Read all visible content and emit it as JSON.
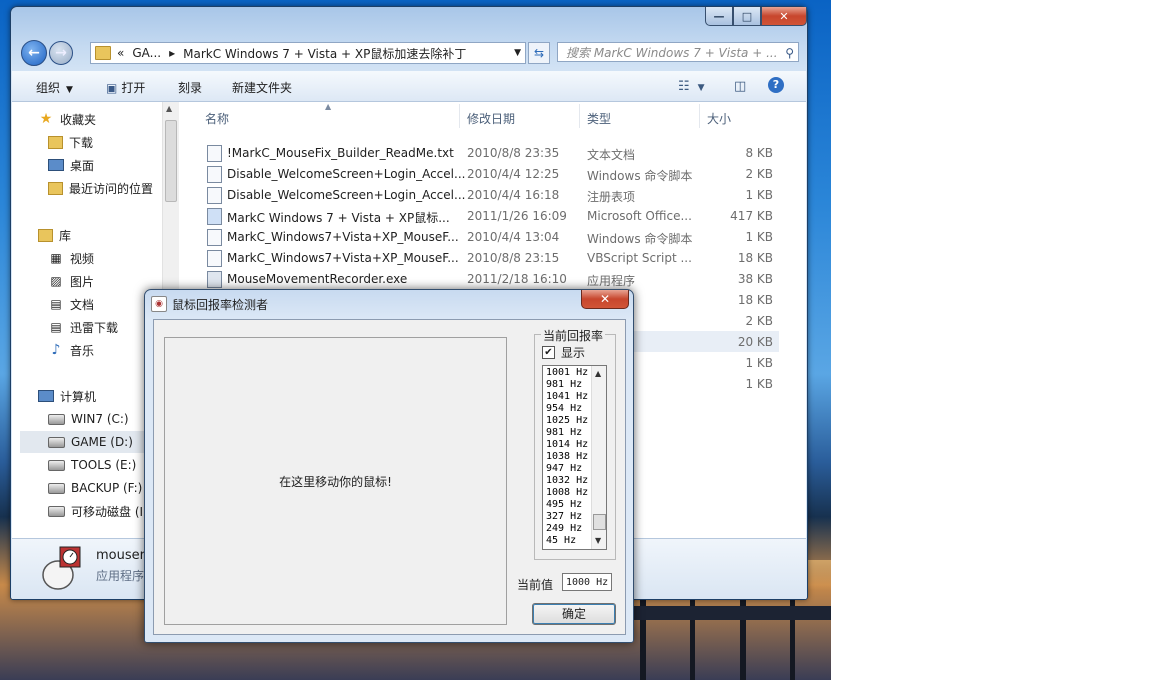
{
  "explorer": {
    "address_segments": [
      "«",
      "GA...",
      "▸",
      "MarkC Windows 7 + Vista + XP鼠标加速去除补丁"
    ],
    "search_placeholder": "搜索 MarkC Windows 7 + Vista + ...",
    "toolbar": {
      "organize": "组织",
      "open": "打开",
      "burn": "刻录",
      "new_folder": "新建文件夹"
    },
    "nav": {
      "favorites_header": "收藏夹",
      "favorites": [
        "下载",
        "桌面",
        "最近访问的位置"
      ],
      "libraries_header": "库",
      "libraries": [
        "视频",
        "图片",
        "文档",
        "迅雷下载",
        "音乐"
      ],
      "computer_header": "计算机",
      "drives": [
        "WIN7 (C:)",
        "GAME (D:)",
        "TOOLS (E:)",
        "BACKUP (F:)",
        "可移动磁盘 (I:"
      ]
    },
    "columns": {
      "name": "名称",
      "date": "修改日期",
      "type": "类型",
      "size": "大小"
    },
    "files": [
      {
        "name": "!MarkC_MouseFix_Builder_ReadMe.txt",
        "date": "2010/8/8 23:35",
        "type": "文本文档",
        "size": "8 KB"
      },
      {
        "name": "Disable_WelcomeScreen+Login_Accel...",
        "date": "2010/4/4 12:25",
        "type": "Windows 命令脚本",
        "size": "2 KB"
      },
      {
        "name": "Disable_WelcomeScreen+Login_Accel...",
        "date": "2010/4/4 16:18",
        "type": "注册表项",
        "size": "1 KB"
      },
      {
        "name": "MarkC Windows 7 + Vista + XP鼠标...",
        "date": "2011/1/26 16:09",
        "type": "Microsoft Office...",
        "size": "417 KB"
      },
      {
        "name": "MarkC_Windows7+Vista+XP_MouseF...",
        "date": "2010/4/4 13:04",
        "type": "Windows 命令脚本",
        "size": "1 KB"
      },
      {
        "name": "MarkC_Windows7+Vista+XP_MouseF...",
        "date": "2010/8/8 23:15",
        "type": "VBScript Script ...",
        "size": "18 KB"
      },
      {
        "name": "MouseMovementRecorder.exe",
        "date": "2011/2/18 16:10",
        "type": "应用程序",
        "size": "38 KB"
      }
    ],
    "hidden_sizes": [
      "18 KB",
      "2 KB",
      "20 KB",
      "1 KB",
      "1 KB"
    ],
    "details": {
      "name": "mouser",
      "type": "应用程序"
    }
  },
  "dialog": {
    "title": "鼠标回报率检测者",
    "close": "✕",
    "move_prompt": "在这里移动你的鼠标!",
    "group_label": "当前回报率",
    "show_label": "显示",
    "show_checked": "✔",
    "rates": [
      "1001 Hz",
      "981 Hz",
      "1041 Hz",
      "954 Hz",
      "1025 Hz",
      "981 Hz",
      "1014 Hz",
      "1038 Hz",
      "947 Hz",
      "1032 Hz",
      "1008 Hz",
      "495 Hz",
      "327 Hz",
      "249 Hz",
      "45 Hz"
    ],
    "current_label": "当前值",
    "current_value": "1000 Hz",
    "ok_label": "确定"
  }
}
